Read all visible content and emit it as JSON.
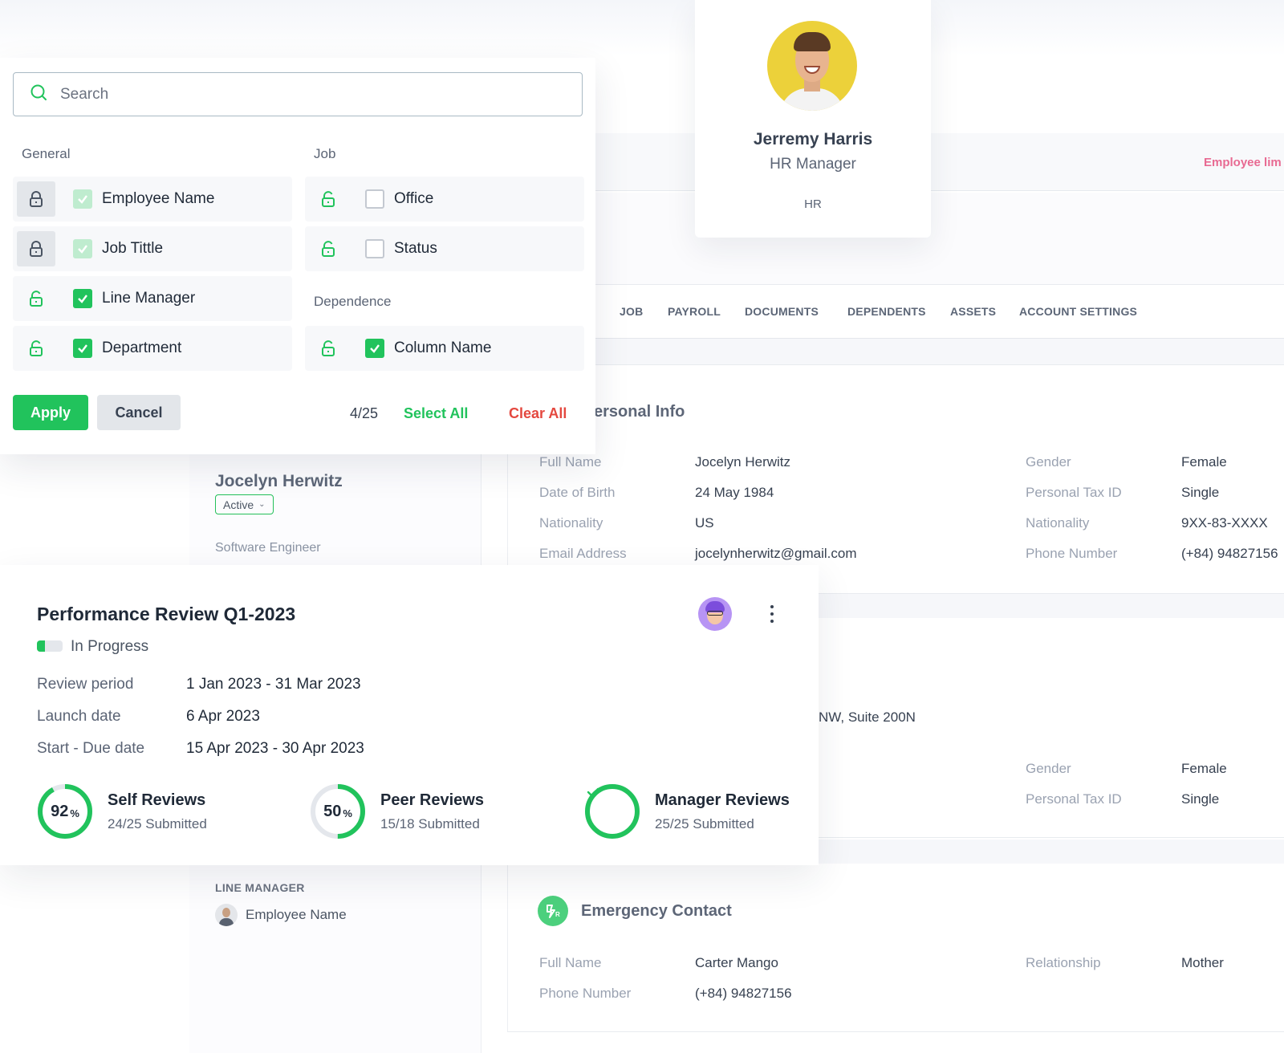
{
  "header": {
    "employee_limit": "Employee lim"
  },
  "profile_card": {
    "name": "Jerremy Harris",
    "title": "HR Manager",
    "department": "HR"
  },
  "tabs": [
    "JOB",
    "PAYROLL",
    "DOCUMENTS",
    "DEPENDENTS",
    "ASSETS",
    "ACCOUNT SETTINGS"
  ],
  "filter": {
    "search_placeholder": "Search",
    "groups": {
      "general": "General",
      "job": "Job",
      "dependence": "Dependence"
    },
    "options": {
      "employee_name": "Employee Name",
      "job_title": "Job Tittle",
      "line_manager": "Line Manager",
      "department": "Department",
      "office": "Office",
      "status": "Status",
      "column_name": "Column Name"
    },
    "apply": "Apply",
    "cancel": "Cancel",
    "count": "4/25",
    "select_all": "Select All",
    "clear_all": "Clear All"
  },
  "employee": {
    "name": "Jocelyn Herwitz",
    "status": "Active",
    "job": "Software Engineer",
    "line_manager_label": "LINE MANAGER",
    "line_manager_name": "Employee Name"
  },
  "personal_info": {
    "title": "ersonal Info",
    "labels": {
      "full_name": "Full Name",
      "dob": "Date of Birth",
      "nationality": "Nationality",
      "email": "Email Address",
      "gender": "Gender",
      "tax_id": "Personal Tax ID",
      "nationality2": "Nationality",
      "phone": "Phone Number"
    },
    "values": {
      "full_name": "Jocelyn Herwitz",
      "dob": "24 May 1984",
      "nationality": "US",
      "email": "jocelynherwitz@gmail.com",
      "gender": "Female",
      "tax_id": "Single",
      "nationality2": "9XX-83-XXXX",
      "phone": "(+84) 94827156"
    }
  },
  "address": {
    "street": "NW, Suite 200N",
    "gender_label": "Gender",
    "gender": "Female",
    "tax_label": "Personal Tax ID",
    "tax": "Single"
  },
  "emergency": {
    "title": "Emergency Contact",
    "full_name_label": "Full Name",
    "full_name": "Carter Mango",
    "phone_label": "Phone Number",
    "phone": "(+84) 94827156",
    "relationship_label": "Relationship",
    "relationship": "Mother"
  },
  "performance": {
    "title": "Performance Review Q1-2023",
    "status": "In Progress",
    "status_progress": 0.3,
    "review_period_label": "Review period",
    "review_period": "1 Jan 2023 - 31 Mar 2023",
    "launch_label": "Launch date",
    "launch": "6 Apr 2023",
    "due_label": "Start - Due date",
    "due": "15 Apr 2023 - 30 Apr 2023",
    "self": {
      "title": "Self Reviews",
      "sub": "24/25 Submitted",
      "pct": "92",
      "value": 0.92
    },
    "peer": {
      "title": "Peer Reviews",
      "sub": "15/18 Submitted",
      "pct": "50",
      "value": 0.5
    },
    "manager": {
      "title": "Manager Reviews",
      "sub": "25/25 Submitted",
      "value": 1.0
    },
    "pct_sign": "%"
  },
  "colors": {
    "accent": "#21c35c",
    "danger": "#e4483f",
    "pink": "#e86a92"
  }
}
